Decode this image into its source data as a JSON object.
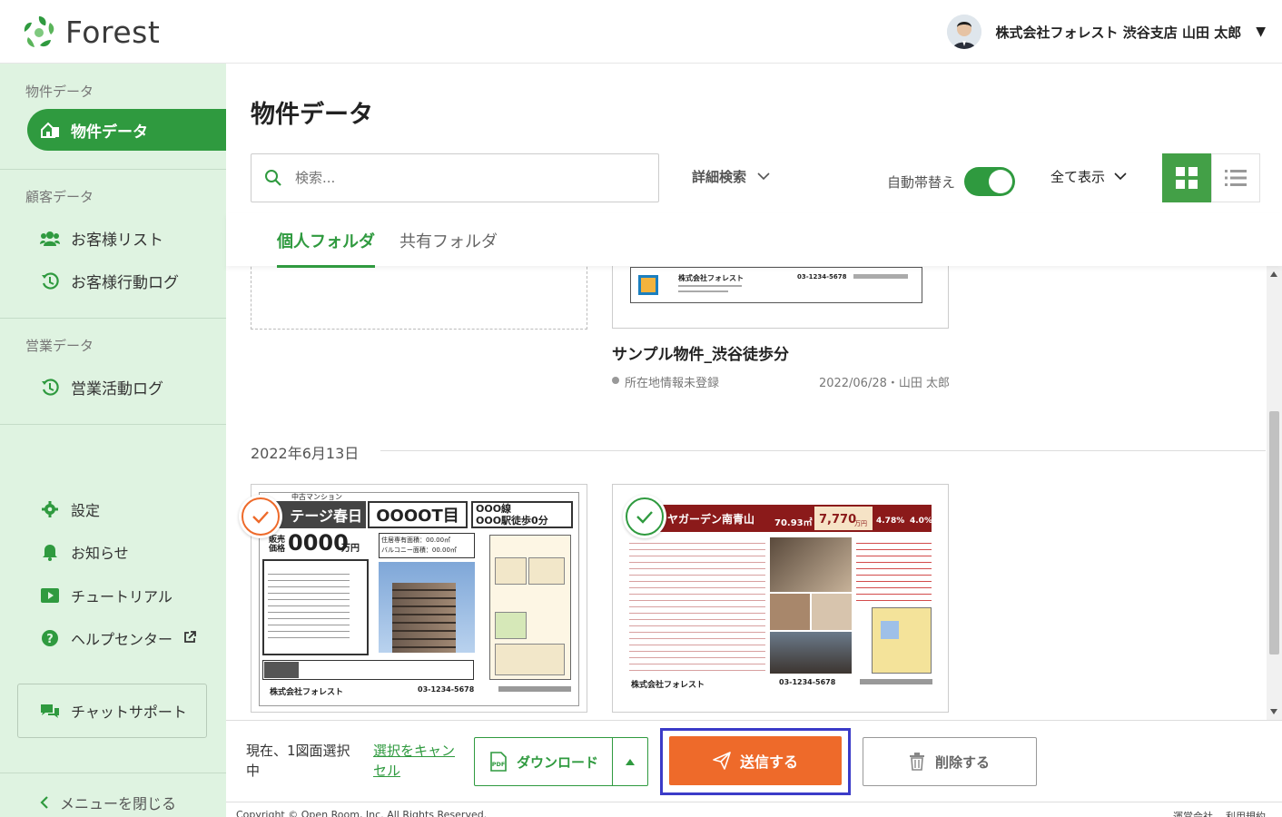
{
  "header": {
    "logo_text": "Forest",
    "user_name": "株式会社フォレスト 渋谷支店 山田 太郎",
    "caret": "▼"
  },
  "sidebar": {
    "section1": "物件データ",
    "active_item": "物件データ",
    "section2": "顧客データ",
    "items_customer": [
      "お客様リスト",
      "お客様行動ログ"
    ],
    "section3": "営業データ",
    "items_sales": [
      "営業活動ログ"
    ],
    "settings": "設定",
    "notice": "お知らせ",
    "tutorial": "チュートリアル",
    "help": "ヘルプセンター",
    "chat": "チャットサポート",
    "close_menu": "メニューを閉じる"
  },
  "main": {
    "title": "物件データ",
    "search_placeholder": "検索...",
    "advanced_search": "詳細検索",
    "auto_switch": "自動帯替え",
    "show_all": "全て表示",
    "tabs": [
      "個人フォルダ",
      "共有フォルダ"
    ]
  },
  "listing": {
    "prop1_title": "サンプル物件_渋谷徒歩分",
    "prop1_status": "所在地情報未登録",
    "prop1_date": "2022/06/28・山田 太郎",
    "date_header": "2022年6月13日",
    "card1": {
      "type": "中古マンション",
      "name": "テージ春日",
      "addr": "OOOOT目",
      "line": "OOO線",
      "station": "OOO駅徒歩0分",
      "price_label1": "販売",
      "price_label2": "価格",
      "price": "0000",
      "price_unit": "万円",
      "area1": "住居専有面積：00.00㎡",
      "area2": "バルコニー面積：00.00㎡",
      "company": "株式会社フォレスト",
      "tel": "03-1234-5678"
    },
    "card2": {
      "name": "ヤガーデン南青山",
      "area": "70.93㎡",
      "price": "7,770",
      "price_unit": "万円",
      "rate1": "4.78%",
      "rate2": "4.0%",
      "company": "株式会社フォレスト",
      "tel": "03-1234-5678"
    },
    "card0": {
      "company": "株式会社フォレスト",
      "tel": "03-1234-5678"
    }
  },
  "bottom": {
    "selection_text": "現在、1図面選択中",
    "cancel": "選択をキャンセル",
    "download": "ダウンロード",
    "send": "送信する",
    "delete": "削除する"
  },
  "footer": {
    "copyright": "Copyright © Open Room, Inc. All Rights Reserved.",
    "link1": "運営会社",
    "link2": "利用規約"
  },
  "colors": {
    "brand_green": "#2f9a3f",
    "sidebar_bg": "#dff3e1",
    "send_orange": "#ee6a2a",
    "highlight": "#3b3bc8"
  }
}
